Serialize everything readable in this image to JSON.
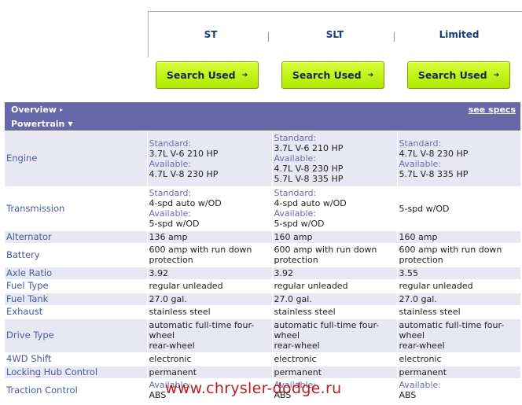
{
  "trims": [
    "ST",
    "SLT",
    "Limited"
  ],
  "search_button_label": "Search Used",
  "search_arrow": "➔",
  "overview": {
    "label": "Overview",
    "caret": "▸",
    "link": "see specs"
  },
  "powertrain": {
    "label": "Powertrain",
    "caret": "▼"
  },
  "rows": [
    {
      "label": "Engine",
      "shade": true,
      "h": 70,
      "cells": [
        [
          {
            "k": "Standard:"
          },
          {
            "v": "3.7L V-6 210 HP"
          },
          {
            "k": "Available:"
          },
          {
            "v": "4.7L V-8 230 HP"
          }
        ],
        [
          {
            "k": "Standard:"
          },
          {
            "v": "3.7L V-6 210 HP"
          },
          {
            "k": "Available:"
          },
          {
            "v": "4.7L V-8 230 HP"
          },
          {
            "v": "5.7L V-8 335 HP"
          }
        ],
        [
          {
            "k": "Standard:"
          },
          {
            "v": "4.7L V-8 230 HP"
          },
          {
            "k": "Available:"
          },
          {
            "v": "5.7L V-8 335 HP"
          }
        ]
      ]
    },
    {
      "label": "Transmission",
      "shade": false,
      "h": 56,
      "cells": [
        [
          {
            "k": "Standard:"
          },
          {
            "v": "4-spd auto w/OD"
          },
          {
            "k": "Available:"
          },
          {
            "v": "5-spd w/OD"
          }
        ],
        [
          {
            "k": "Standard:"
          },
          {
            "v": "4-spd auto w/OD"
          },
          {
            "k": "Available:"
          },
          {
            "v": "5-spd w/OD"
          }
        ],
        [
          {
            "v": "5-spd w/OD"
          }
        ]
      ]
    },
    {
      "label": "Alternator",
      "shade": true,
      "h": 16,
      "cells": [
        [
          {
            "v": "136 amp"
          }
        ],
        [
          {
            "v": "160 amp"
          }
        ],
        [
          {
            "v": "160 amp"
          }
        ]
      ]
    },
    {
      "label": "Battery",
      "shade": false,
      "h": 30,
      "cells": [
        [
          {
            "v": "600 amp with run down"
          },
          {
            "v": "protection"
          }
        ],
        [
          {
            "v": "600 amp with run down"
          },
          {
            "v": "protection"
          }
        ],
        [
          {
            "v": "600 amp with run down"
          },
          {
            "v": "protection"
          }
        ]
      ]
    },
    {
      "label": "Axle Ratio",
      "shade": true,
      "h": 16,
      "cells": [
        [
          {
            "v": "3.92"
          }
        ],
        [
          {
            "v": "3.92"
          }
        ],
        [
          {
            "v": "3.55"
          }
        ]
      ]
    },
    {
      "label": "Fuel Type",
      "shade": false,
      "h": 17,
      "cells": [
        [
          {
            "v": "regular unleaded"
          }
        ],
        [
          {
            "v": "regular unleaded"
          }
        ],
        [
          {
            "v": "regular unleaded"
          }
        ]
      ]
    },
    {
      "label": "Fuel Tank",
      "shade": true,
      "h": 16,
      "cells": [
        [
          {
            "v": "27.0 gal."
          }
        ],
        [
          {
            "v": "27.0 gal."
          }
        ],
        [
          {
            "v": "27.0 gal."
          }
        ]
      ]
    },
    {
      "label": "Exhaust",
      "shade": false,
      "h": 17,
      "cells": [
        [
          {
            "v": "stainless steel"
          }
        ],
        [
          {
            "v": "stainless steel"
          }
        ],
        [
          {
            "v": "stainless steel"
          }
        ]
      ]
    },
    {
      "label": "Drive Type",
      "shade": true,
      "h": 43,
      "cells": [
        [
          {
            "v": "automatic full-time four-"
          },
          {
            "v": "wheel"
          },
          {
            "v": "rear-wheel"
          }
        ],
        [
          {
            "v": "automatic full-time four-"
          },
          {
            "v": "wheel"
          },
          {
            "v": "rear-wheel"
          }
        ],
        [
          {
            "v": "automatic full-time four-"
          },
          {
            "v": "wheel"
          },
          {
            "v": "rear-wheel"
          }
        ]
      ]
    },
    {
      "label": "4WD Shift",
      "shade": false,
      "h": 17,
      "cells": [
        [
          {
            "v": "electronic"
          }
        ],
        [
          {
            "v": "electronic"
          }
        ],
        [
          {
            "v": "electronic"
          }
        ]
      ]
    },
    {
      "label": "Locking Hub Control",
      "shade": true,
      "h": 16,
      "cells": [
        [
          {
            "v": "permanent"
          }
        ],
        [
          {
            "v": "permanent"
          }
        ],
        [
          {
            "v": "permanent"
          }
        ]
      ]
    },
    {
      "label": "Traction Control",
      "shade": false,
      "h": 30,
      "cells": [
        [
          {
            "k": "Available:"
          },
          {
            "v": "ABS"
          }
        ],
        [
          {
            "k": "Available:"
          },
          {
            "v": "ABS"
          }
        ],
        [
          {
            "k": "Available:"
          },
          {
            "v": "ABS"
          }
        ]
      ]
    }
  ],
  "watermark": "www.chrysler-dodge.ru"
}
